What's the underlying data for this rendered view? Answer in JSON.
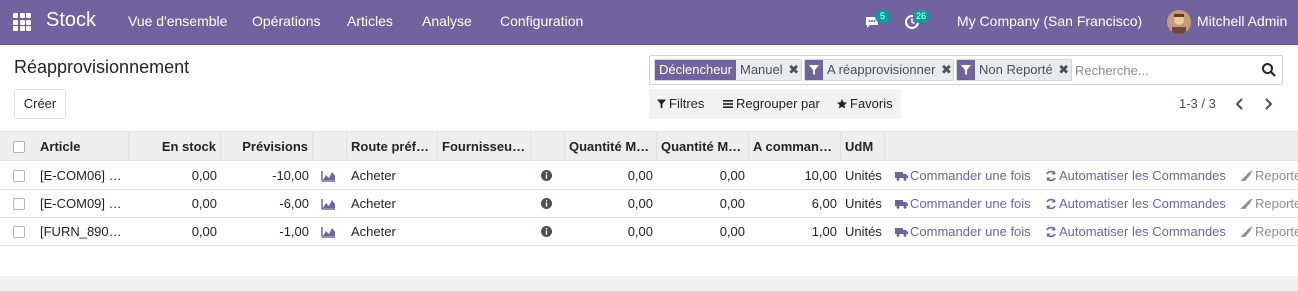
{
  "navbar": {
    "app_name": "Stock",
    "menu": [
      "Vue d'ensemble",
      "Opérations",
      "Articles",
      "Analyse",
      "Configuration"
    ],
    "messages_count": "5",
    "activities_count": "26",
    "company": "My Company (San Francisco)",
    "user": "Mitchell Admin",
    "color": "#71639e"
  },
  "page": {
    "title": "Réapprovisionnement",
    "create_label": "Créer"
  },
  "search": {
    "facets": [
      {
        "label": "Déclencheur",
        "value": "Manuel",
        "type": "field"
      },
      {
        "label": "filter-icon",
        "value": "A réapprovisionner",
        "type": "filter"
      },
      {
        "label": "filter-icon",
        "value": "Non Reporté",
        "type": "filter"
      }
    ],
    "placeholder": "Recherche..."
  },
  "filterbar": {
    "filters": "Filtres",
    "groupby": "Regrouper par",
    "favorites": "Favoris"
  },
  "pager": {
    "text": "1-3 / 3"
  },
  "table": {
    "columns": [
      "Article",
      "En stock",
      "Prévisions",
      "",
      "Route préf…",
      "Fournisseu…",
      "",
      "Quantité M…",
      "Quantité M…",
      "A comman…",
      "UdM"
    ],
    "rows": [
      {
        "article": "[E-COM06] …",
        "stock": "0,00",
        "forecast": "-10,00",
        "route": "Acheter",
        "qmin": "0,00",
        "qmax": "0,00",
        "order": "10,00",
        "uom": "Unités"
      },
      {
        "article": "[E-COM09] …",
        "stock": "0,00",
        "forecast": "-6,00",
        "route": "Acheter",
        "qmin": "0,00",
        "qmax": "0,00",
        "order": "6,00",
        "uom": "Unités"
      },
      {
        "article": "[FURN_890…",
        "stock": "0,00",
        "forecast": "-1,00",
        "route": "Acheter",
        "qmin": "0,00",
        "qmax": "0,00",
        "order": "1,00",
        "uom": "Unités"
      }
    ],
    "actions": {
      "order_once": "Commander une fois",
      "automate": "Automatiser les Commandes",
      "snooze": "Reporte"
    }
  }
}
